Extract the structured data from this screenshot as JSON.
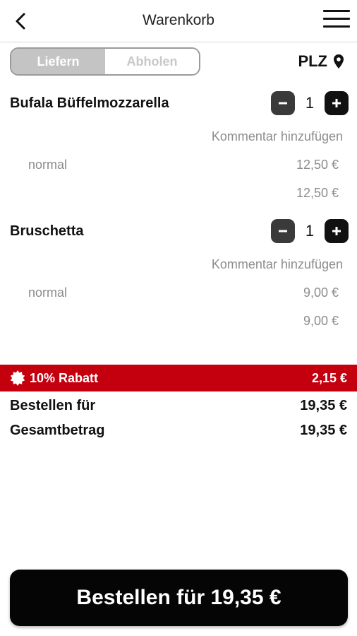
{
  "header": {
    "title": "Warenkorb",
    "back_icon": "chevron-left-icon",
    "menu_icon": "hamburger-menu-icon"
  },
  "delivery_toggle": {
    "options": [
      "Liefern",
      "Abholen"
    ],
    "selected": "Liefern"
  },
  "plz": {
    "label": "PLZ",
    "icon": "location-pin-icon"
  },
  "cart": {
    "items": [
      {
        "name": "Bufala Büffelmozzarella",
        "quantity": "1",
        "comment_label": "Kommentar hinzufügen",
        "variant": "normal",
        "variant_price": "12,50 €",
        "line_total": "12,50 €"
      },
      {
        "name": "Bruschetta",
        "quantity": "1",
        "comment_label": "Kommentar hinzufügen",
        "variant": "normal",
        "variant_price": "9,00 €",
        "line_total": "9,00 €"
      }
    ]
  },
  "discount": {
    "label": "10% Rabatt",
    "value": "2,15 €",
    "color": "#c4000f",
    "icon": "discount-badge-icon"
  },
  "summary": {
    "order_for_label": "Bestellen für",
    "order_for_value": "19,35 €",
    "total_label": "Gesamtbetrag",
    "total_value": "19,35 €"
  },
  "checkout_button": {
    "label": "Bestellen für 19,35 €"
  }
}
